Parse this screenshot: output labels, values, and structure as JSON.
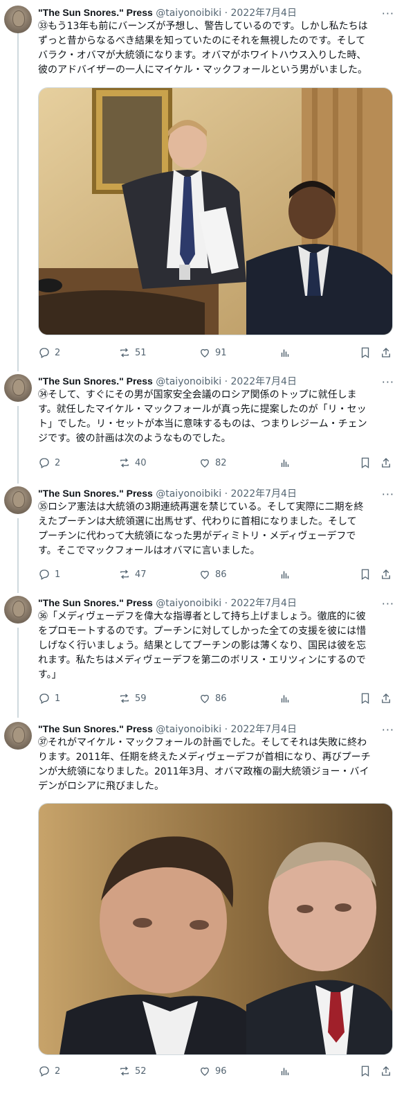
{
  "tweets": [
    {
      "name": "\"The Sun Snores.\" Press",
      "handle": "@taiyonoibiki",
      "date": "2022年7月4日",
      "lines": [
        "㉝もう13年も前にバーンズが予想し、警告しているのです。しかし私たちは",
        "ずっと昔からなるべき結果を知っていたのにそれを無視したのです。そして",
        "バラク・オバマが大統領になります。オバマがホワイトハウス入りした時、",
        "彼のアドバイザーの一人にマイケル・マックフォールという男がいました。"
      ],
      "replies": "2",
      "retweets": "51",
      "likes": "91"
    },
    {
      "name": "\"The Sun Snores.\" Press",
      "handle": "@taiyonoibiki",
      "date": "2022年7月4日",
      "lines": [
        "㉞そして、すぐにその男が国家安全会議のロシア関係のトップに就任しま",
        "す。就任したマイケル・マックフォールが真っ先に提案したのが「リ・セッ",
        "ト」でした。リ・セットが本当に意味するものは、つまりレジーム・チェン",
        "ジです。彼の計画は次のようなものでした。"
      ],
      "replies": "2",
      "retweets": "40",
      "likes": "82"
    },
    {
      "name": "\"The Sun Snores.\" Press",
      "handle": "@taiyonoibiki",
      "date": "2022年7月4日",
      "lines": [
        "㉟ロシア憲法は大統領の3期連続再選を禁じている。そして実際に二期を終",
        "えたプーチンは大統領選に出馬せず、代わりに首相になりました。そして",
        "プーチンに代わって大統領になった男がディミトリ・メディヴェーデフで",
        "す。そこでマックフォールはオバマに言いました。"
      ],
      "replies": "1",
      "retweets": "47",
      "likes": "86"
    },
    {
      "name": "\"The Sun Snores.\" Press",
      "handle": "@taiyonoibiki",
      "date": "2022年7月4日",
      "lines": [
        "㊱「メディヴェーデフを偉大な指導者として持ち上げましょう。徹底的に彼",
        "をプロモートするのです。プーチンに対してしかった全ての支援を彼には惜",
        "しげなく行いましょう。結果としてプーチンの影は薄くなり、国民は彼を忘",
        "れます。私たちはメディヴェーデフを第二のボリス・エリツィンにするので",
        "す。」"
      ],
      "replies": "1",
      "retweets": "59",
      "likes": "86"
    },
    {
      "name": "\"The Sun Snores.\" Press",
      "handle": "@taiyonoibiki",
      "date": "2022年7月4日",
      "lines": [
        "㊲それがマイケル・マックフォールの計画でした。そしてそれは失敗に終わ",
        "ります。2011年、任期を終えたメディヴェーデフが首相になり、再びプーチ",
        "ンが大統領になりました。2011年3月、オバマ政権の副大統領ジョー・バイ",
        "デンがロシアに飛びました。"
      ],
      "replies": "2",
      "retweets": "52",
      "likes": "96"
    }
  ],
  "separator": "·",
  "more_glyph": "···",
  "colors": {
    "text": "#0f1419",
    "muted": "#536471",
    "border": "#cfd9de"
  }
}
